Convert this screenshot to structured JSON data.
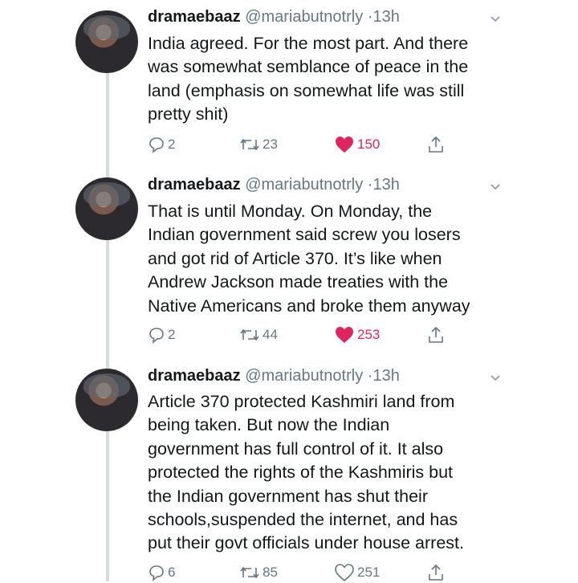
{
  "tweets": [
    {
      "name": "dramaebaaz",
      "handle": "@mariabutnotrly",
      "time": "13h",
      "lines": [
        "India agreed. For the most part. And there",
        "was somewhat semblance of peace in the",
        "land (emphasis on somewhat life was still",
        "pretty shit)"
      ],
      "replies": "2",
      "retweets": "23",
      "likes": "150",
      "liked": true
    },
    {
      "name": "dramaebaaz",
      "handle": "@mariabutnotrly",
      "time": "13h",
      "lines": [
        "That is until Monday. On Monday, the",
        "Indian government said screw you losers",
        "and got rid of Article 370. It’s like when",
        "Andrew Jackson made treaties with the",
        "Native Americans and broke them anyway"
      ],
      "replies": "2",
      "retweets": "44",
      "likes": "253",
      "liked": true
    },
    {
      "name": "dramaebaaz",
      "handle": "@mariabutnotrly",
      "time": "13h",
      "lines": [
        "Article 370 protected Kashmiri land from",
        "being taken. But now the Indian",
        "government has full control of it. It also",
        "protected the rights of the Kashmiris but",
        "the Indian government has shut their",
        "schools,suspended the internet, and has",
        "put their govt officials under house arrest."
      ],
      "replies": "6",
      "retweets": "85",
      "likes": "251",
      "liked": false
    }
  ],
  "colors": {
    "like_active": "#e0245e",
    "muted": "#657786",
    "thread_line": "#d5dbe0"
  },
  "icons": {
    "reply": "speech-bubble-icon",
    "retweet": "retweet-arrows-icon",
    "like": "heart-icon",
    "share": "share-upload-icon",
    "more": "chevron-down-icon"
  }
}
